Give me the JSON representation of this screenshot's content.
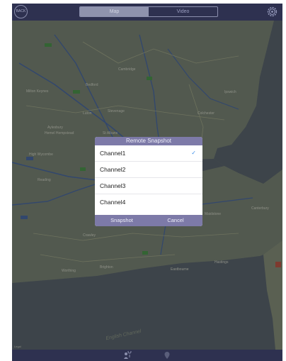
{
  "topbar": {
    "back_label": "BACK",
    "tabs": [
      {
        "label": "Map",
        "active": true
      },
      {
        "label": "Video",
        "active": false
      }
    ],
    "settings_icon": "gear-icon"
  },
  "map": {
    "labels": [
      "Cambridge",
      "Milton Keynes",
      "Bedford",
      "Luton",
      "Stevenage",
      "Colchester",
      "Ipswich",
      "Aylesbury",
      "Hemel Hempstead",
      "St Albans",
      "High Wycombe",
      "Reading",
      "Maidstone",
      "Canterbury",
      "Crawley",
      "Brighton",
      "Hastings",
      "Eastbourne",
      "Worthing"
    ],
    "watermark": "English Channel",
    "legal": "Legal"
  },
  "dialog": {
    "title": "Remote Snapshot",
    "channels": [
      {
        "label": "Channel1",
        "checked": true
      },
      {
        "label": "Channel2",
        "checked": false
      },
      {
        "label": "Channel3",
        "checked": false
      },
      {
        "label": "Channel4",
        "checked": false
      }
    ],
    "snapshot_label": "Snapshot",
    "cancel_label": "Cancel",
    "check_mark": "✓"
  },
  "bottombar": {
    "icons": [
      "person-pin-icon",
      "location-icon"
    ]
  }
}
